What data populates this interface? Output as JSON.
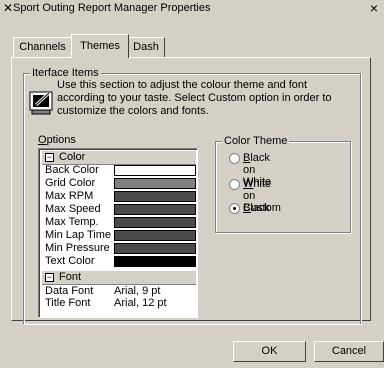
{
  "titlebar": {
    "title": "Sport Outing Report Manager Properties",
    "app_icon": "x-icon",
    "close_glyph": "×"
  },
  "tabs": [
    {
      "label": "Channels"
    },
    {
      "label": "Themes",
      "active": true
    },
    {
      "label": "Dash"
    }
  ],
  "interface_items": {
    "group_label": "Iterface Items",
    "description": "Use this section to adjust the colour theme and font according to your taste. Select Custom option in order to customize the colors and fonts."
  },
  "options": {
    "label_prefix": "",
    "label_underlined": "O",
    "label_rest": "ptions",
    "color_category": "Color",
    "color_rows": [
      {
        "name": "Back Color",
        "color": "#ffffff"
      },
      {
        "name": "Grid Color",
        "color": "#808080"
      },
      {
        "name": "Max RPM",
        "color": "#4a4a4a"
      },
      {
        "name": "Max Speed",
        "color": "#4a4a4a"
      },
      {
        "name": "Max Temp.",
        "color": "#4a4a4a"
      },
      {
        "name": "Min Lap Time",
        "color": "#4a4a4a"
      },
      {
        "name": "Min Pressure",
        "color": "#4a4a4a"
      },
      {
        "name": "Text Color",
        "color": "#000000"
      }
    ],
    "font_category": "Font",
    "font_rows": [
      {
        "name": "Data Font",
        "value": "Arial, 9 pt"
      },
      {
        "name": "Title Font",
        "value": "Arial, 12 pt"
      }
    ]
  },
  "color_theme": {
    "group_label": "Color Theme",
    "options": [
      {
        "underlined": "B",
        "rest": "lack on White",
        "selected": false
      },
      {
        "underlined": "W",
        "rest": "hite on Black",
        "selected": false
      },
      {
        "underlined": "C",
        "rest": "ustom",
        "selected": true
      }
    ]
  },
  "buttons": {
    "ok": "OK",
    "cancel": "Cancel"
  }
}
